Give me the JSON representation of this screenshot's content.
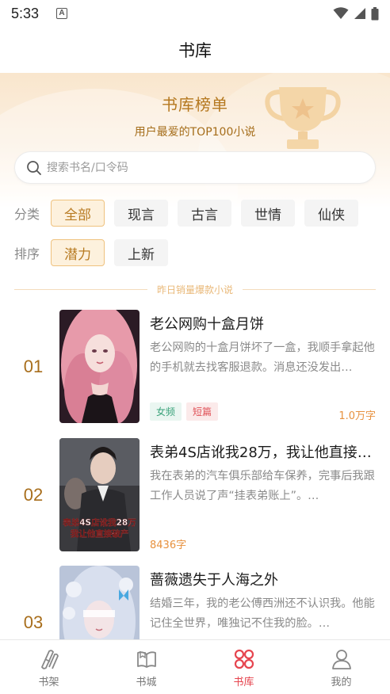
{
  "status_bar": {
    "time": "5:33",
    "notification_icon": "A"
  },
  "header": {
    "title": "书库"
  },
  "banner": {
    "title": "书库榜单",
    "subtitle": "用户最爱的TOP100小说",
    "icon": "trophy-icon"
  },
  "search": {
    "placeholder": "搜索书名/口令码"
  },
  "filters": {
    "category": {
      "label": "分类",
      "options": [
        "全部",
        "现言",
        "古言",
        "世情",
        "仙侠"
      ],
      "selected": "全部"
    },
    "sort": {
      "label": "排序",
      "options": [
        "潜力",
        "上新"
      ],
      "selected": "潜力"
    }
  },
  "section_label": "昨日销量爆款小说",
  "books": [
    {
      "rank": "01",
      "title": "老公网购十盒月饼",
      "description": "老公网购的十盒月饼坏了一盒，我顺手拿起他的手机就去找客服退款。消息还没发出…",
      "tags": [
        "女频",
        "短篇"
      ],
      "word_count": "1.0万字"
    },
    {
      "rank": "02",
      "title": "表弟4S店讹我28万，我让他直接…",
      "description": "我在表弟的汽车俱乐部给车保养，完事后我跟工作人员说了声“挂表弟账上”。…",
      "tags": [],
      "word_count": "8436字",
      "cover_text": [
        "表弟4S店讹我28万",
        "我让他直接破产"
      ]
    },
    {
      "rank": "03",
      "title": "蔷薇遗失于人海之外",
      "description": "结婚三年，我的老公傅西洲还不认识我。他能记住全世界，唯独记不住我的脸。…",
      "tags": [],
      "word_count": ""
    }
  ],
  "tab_bar": {
    "items": [
      {
        "label": "书架",
        "icon": "bookshelf-icon"
      },
      {
        "label": "书城",
        "icon": "book-open-icon"
      },
      {
        "label": "书库",
        "icon": "library-grid-icon"
      },
      {
        "label": "我的",
        "icon": "user-icon"
      }
    ],
    "active": "书库"
  },
  "colors": {
    "accent": "#b87b22",
    "tab_active": "#e6454f",
    "word_count": "#e7913e"
  }
}
